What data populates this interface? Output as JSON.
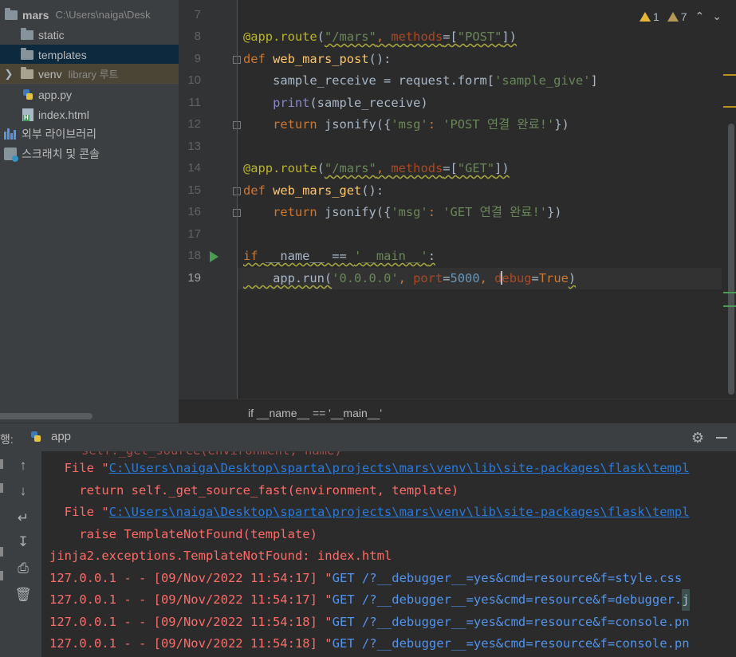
{
  "project": {
    "root_name": "mars",
    "root_path": "C:\\Users\\naiga\\Desk",
    "items": [
      {
        "label": "static"
      },
      {
        "label": "templates"
      },
      {
        "label": "venv",
        "note": "library 루트"
      },
      {
        "label": "app.py"
      },
      {
        "label": "index.html"
      },
      {
        "label": "외부 라이브러리"
      },
      {
        "label": "스크래치 및 콘솔"
      }
    ]
  },
  "editor": {
    "line_numbers": [
      "7",
      "8",
      "9",
      "10",
      "11",
      "12",
      "13",
      "14",
      "15",
      "16",
      "17",
      "18",
      "19"
    ],
    "inspection": {
      "warnings": "1",
      "weak_warnings": "7"
    },
    "code": {
      "l8": {
        "dec": "@app.route",
        "p1": "(",
        "s1": "\"/mars\"",
        "c1": ", ",
        "prm": "methods",
        "eq": "=[",
        "s2": "\"POST\"",
        "end": "])"
      },
      "l9": {
        "kw": "def ",
        "fn": "web_mars_post",
        "rest": "():"
      },
      "l10": {
        "a": "    sample_receive = request.form[",
        "s": "'sample_give'",
        "b": "]"
      },
      "l11": {
        "bi": "    print",
        "rest": "(sample_receive)"
      },
      "l12": {
        "kw": "    return ",
        "a": "jsonify({",
        "s1": "'msg'",
        "c": ": ",
        "s2": "'POST 연결 완료!'",
        "b": "})"
      },
      "l14": {
        "dec": "@app.route",
        "p1": "(",
        "s1": "\"/mars\"",
        "c1": ", ",
        "prm": "methods",
        "eq": "=[",
        "s2": "\"GET\"",
        "end": "])"
      },
      "l15": {
        "kw": "def ",
        "fn": "web_mars_get",
        "rest": "():"
      },
      "l16": {
        "kw": "    return ",
        "a": "jsonify({",
        "s1": "'msg'",
        "c": ": ",
        "s2": "'GET 연결 완료!'",
        "b": "})"
      },
      "l18": {
        "kw": "if ",
        "a": "__name__ == ",
        "s": "'__main__'",
        "b": ":"
      },
      "l19": {
        "a": "    app.run(",
        "s": "'0.0.0.0'",
        "c1": ", ",
        "p1": "port",
        "eq1": "=",
        "n": "5000",
        "c2": ", ",
        "p2a": "d",
        "p2b": "ebug",
        "eq2": "=",
        "kw": "True",
        "b": ")"
      }
    },
    "breadcrumb": "if __name__ == '__main__'"
  },
  "run": {
    "label": "행:",
    "tab_label": "app",
    "ghost_line": "self._get_source(environment, name)",
    "lines": [
      {
        "pre": "  File \"",
        "link": "C:\\Users\\naiga\\Desktop\\sparta\\projects\\mars\\venv\\lib\\site-packages\\flask\\templ"
      },
      {
        "text": "    return self._get_source_fast(environment, template)"
      },
      {
        "pre": "  File \"",
        "link": "C:\\Users\\naiga\\Desktop\\sparta\\projects\\mars\\venv\\lib\\site-packages\\flask\\templ"
      },
      {
        "text": "    raise TemplateNotFound(template)"
      },
      {
        "text": "jinja2.exceptions.TemplateNotFound: index.html"
      },
      {
        "pre": "127.0.0.1 - - [09/Nov/2022 11:54:17] \"",
        "get": "GET /?__debugger__=yes&cmd=resource&f=style.css"
      },
      {
        "pre": "127.0.0.1 - - [09/Nov/2022 11:54:17] \"",
        "get": "GET /?__debugger__=yes&cmd=resource&f=debugger.",
        "tail": "j"
      },
      {
        "pre": "127.0.0.1 - - [09/Nov/2022 11:54:18] \"",
        "get": "GET /?__debugger__=yes&cmd=resource&f=console.pn"
      },
      {
        "pre": "127.0.0.1 - - [09/Nov/2022 11:54:18] \"",
        "get": "GET /?__debugger__=yes&cmd=resource&f=console.pn"
      }
    ]
  },
  "colors": {
    "accent": "#287bde",
    "error_text": "#ff6b68",
    "selection": "#0d293e"
  }
}
